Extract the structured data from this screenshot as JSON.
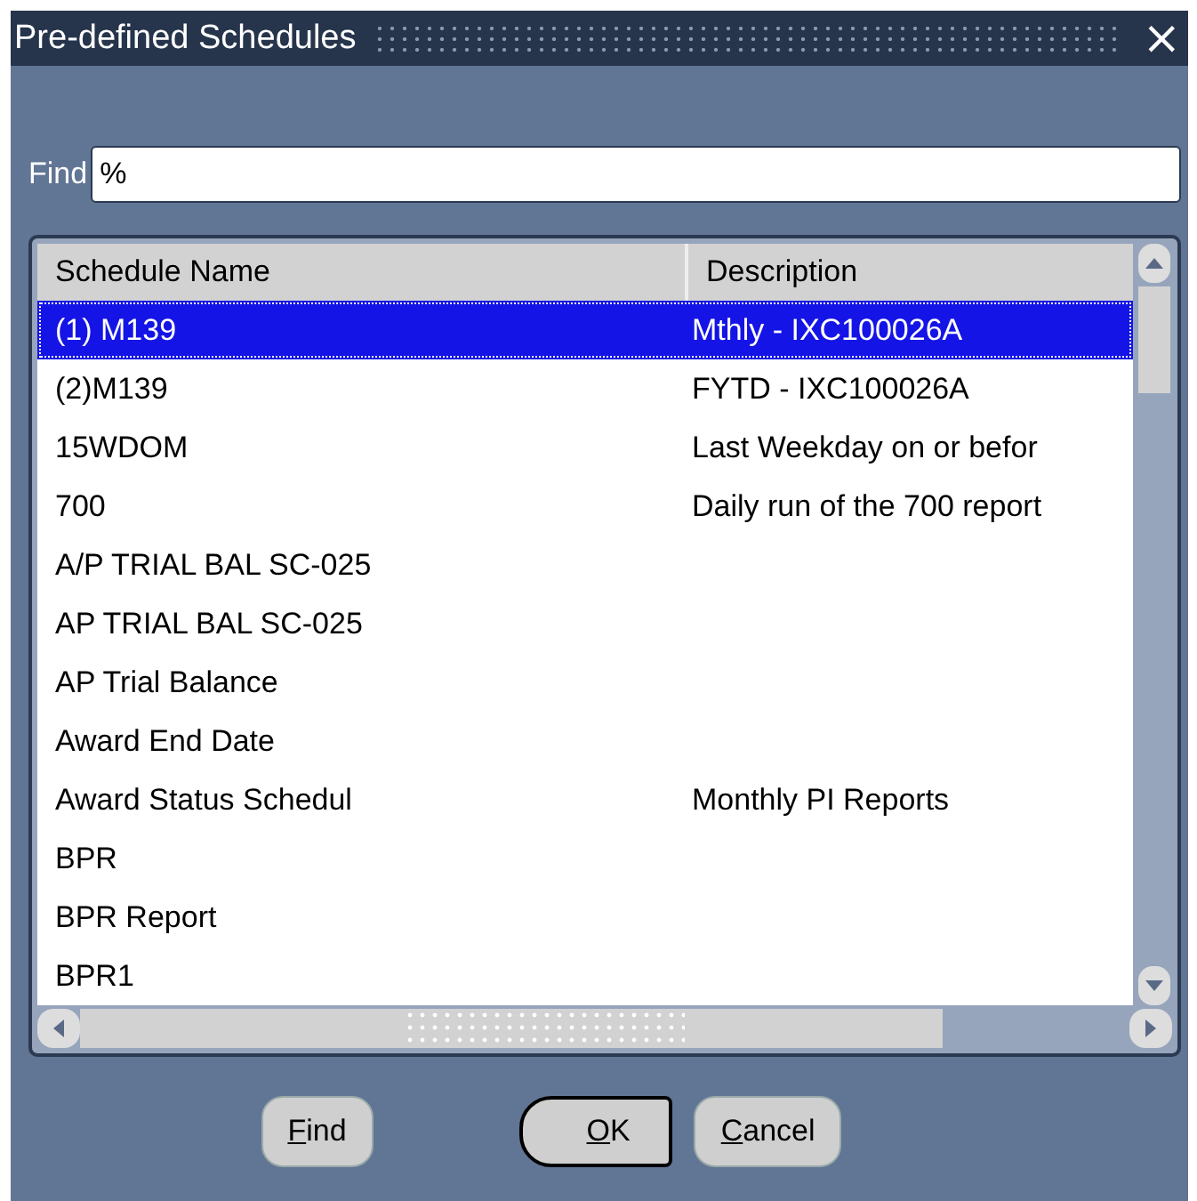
{
  "window": {
    "title": "Pre-defined Schedules",
    "close": "×"
  },
  "find": {
    "label": "Find",
    "value": "%"
  },
  "table": {
    "columns": [
      "Schedule Name",
      "Description"
    ],
    "rows": [
      {
        "name": "(1) M139",
        "description": "Mthly -  IXC100026A",
        "selected": true
      },
      {
        "name": "(2)M139",
        "description": "FYTD -  IXC100026A",
        "selected": false
      },
      {
        "name": "15WDOM",
        "description": "Last Weekday on or befor",
        "selected": false
      },
      {
        "name": "700",
        "description": "Daily run of the 700 report",
        "selected": false
      },
      {
        "name": "A/P TRIAL BAL SC-025",
        "description": "",
        "selected": false
      },
      {
        "name": "AP TRIAL BAL SC-025",
        "description": "",
        "selected": false
      },
      {
        "name": "AP Trial Balance",
        "description": "",
        "selected": false
      },
      {
        "name": "Award End Date",
        "description": "",
        "selected": false
      },
      {
        "name": "Award Status Schedul",
        "description": "Monthly PI Reports",
        "selected": false
      },
      {
        "name": "BPR",
        "description": "",
        "selected": false
      },
      {
        "name": "BPR Report",
        "description": "",
        "selected": false
      },
      {
        "name": "BPR1",
        "description": "",
        "selected": false
      }
    ]
  },
  "buttons": [
    {
      "key": "F",
      "rest": "ind",
      "default": false
    },
    {
      "key": "O",
      "rest": "K",
      "default": true
    },
    {
      "key": "C",
      "rest": "ancel",
      "default": false
    }
  ]
}
